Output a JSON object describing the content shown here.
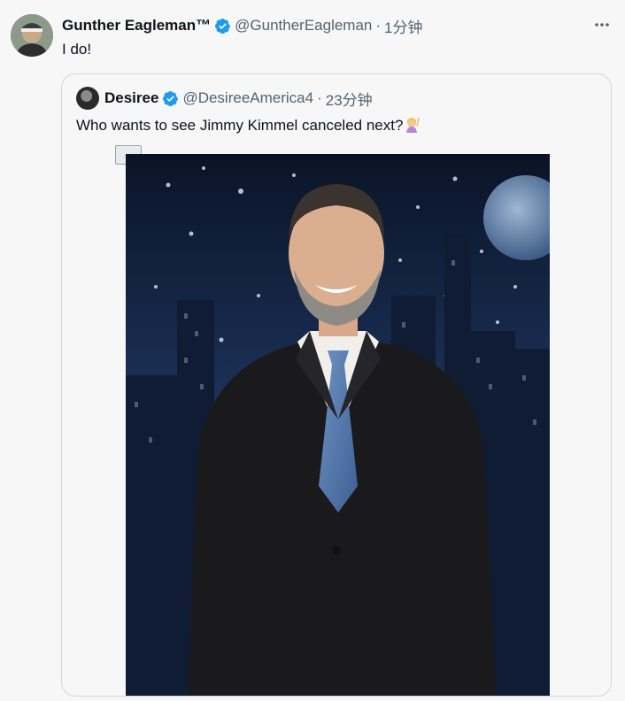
{
  "tweet": {
    "author_name": "Gunther Eagleman™",
    "handle": "@GuntherEagleman",
    "separator": "·",
    "time": "1分钟",
    "text": "I do!",
    "more_icon": "more-icon"
  },
  "quote": {
    "author_name": "Desiree",
    "handle": "@DesireeAmerica4",
    "separator": "·",
    "time": "23分钟",
    "text": "Who wants to see Jimmy Kimmel canceled next?",
    "emoji": "raising-hand-emoji",
    "media": "photo"
  },
  "colors": {
    "verified": "#1d9bf0",
    "secondary_text": "#536471",
    "border": "#d2d7dc"
  }
}
